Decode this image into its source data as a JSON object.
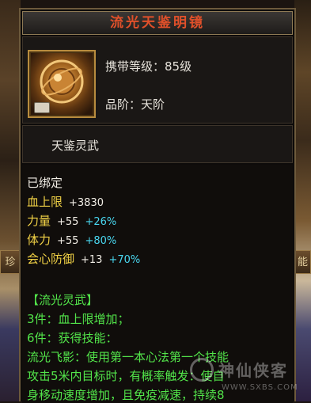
{
  "item": {
    "name": "流光天鉴明镜",
    "carry_level": "携带等级：85级",
    "grade": "品阶：天阶",
    "subtitle": "天鉴灵武",
    "icon": "celestial-mirror-icon"
  },
  "stats": {
    "bound": "已绑定",
    "hp_label": "血上限",
    "hp_value": "+3830",
    "str_label": "力量",
    "str_value": "+55",
    "str_bonus": "+26%",
    "con_label": "体力",
    "con_value": "+55",
    "con_bonus": "+80%",
    "crit_label": "会心防御",
    "crit_value": "+13",
    "crit_bonus": "+70%"
  },
  "set": {
    "header": "【流光灵武】",
    "line1": "3件：血上限增加；",
    "line2": "6件：获得技能：",
    "line3": "流光飞影：使用第一本心法第一个技能",
    "line4": "攻击5米内目标时，有概率触发：使自",
    "line5": "身移动速度增加，且免疫减速，持续8"
  },
  "background": {
    "left_btn": "珍",
    "right_btn": "能"
  },
  "watermark": {
    "text": "神仙侠客",
    "url": "WWW.SXBS.COM"
  },
  "colors": {
    "title": "#e0502a",
    "bonus": "#49d7f0",
    "set_text": "#52e44a",
    "stat_label": "#f2d246"
  }
}
